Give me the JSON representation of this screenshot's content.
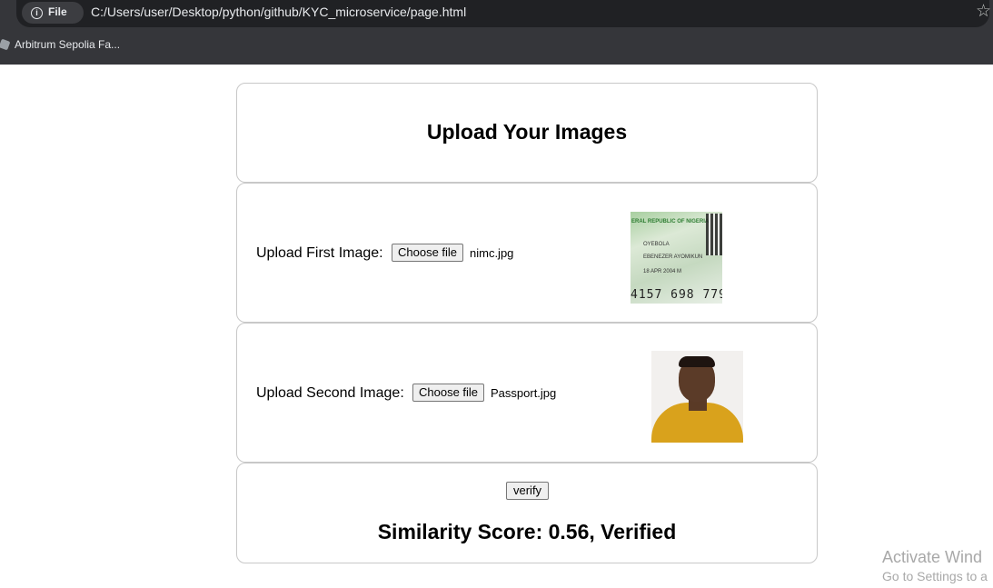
{
  "browser": {
    "chip_label": "File",
    "url": "C:/Users/user/Desktop/python/github/KYC_microservice/page.html",
    "bookmarks": [
      {
        "label": "Arbitrum Sepolia Fa..."
      }
    ]
  },
  "page": {
    "title": "Upload Your Images",
    "first_upload": {
      "label": "Upload First Image:",
      "button_label": "Choose file",
      "file_name": "nimc.jpg"
    },
    "second_upload": {
      "label": "Upload Second Image:",
      "button_label": "Choose file",
      "file_name": "Passport.jpg"
    },
    "verify_label": "verify",
    "result": "Similarity Score: 0.56, Verified"
  },
  "watermark": {
    "line1": "Activate Wind",
    "line2": "Go to Settings to a"
  }
}
